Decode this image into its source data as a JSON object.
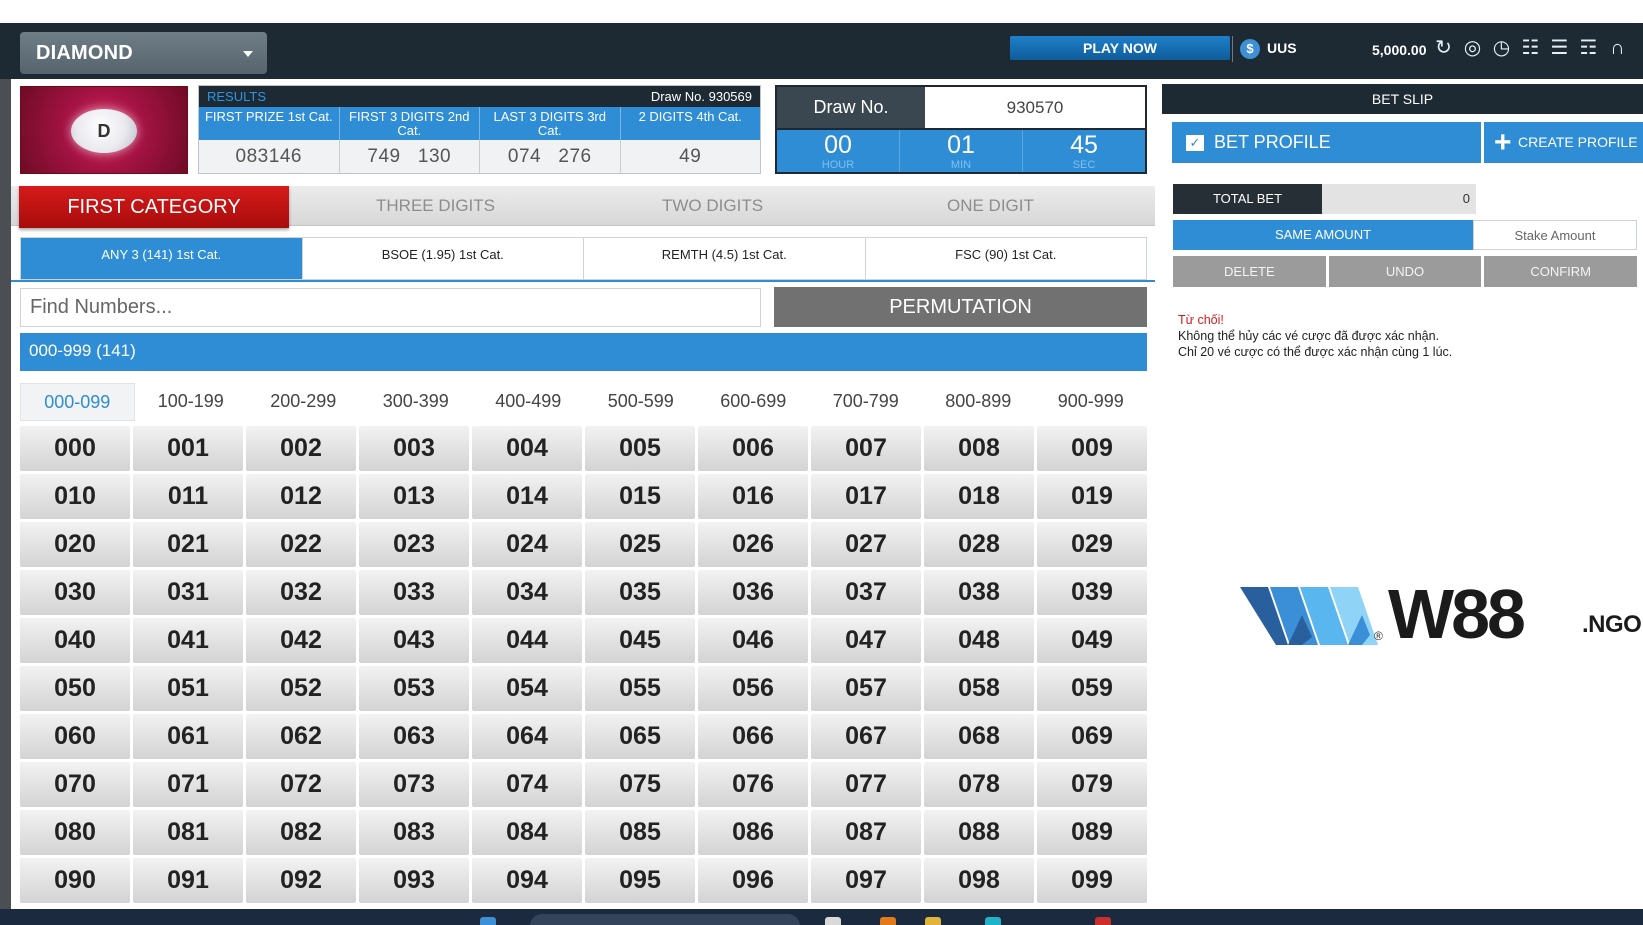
{
  "topbar": {
    "game": "DIAMOND",
    "play_now": "PLAY NOW",
    "currency": "UUS",
    "balance": "5,000.00",
    "tool_icons": [
      "refresh-icon",
      "lifebuoy-icon",
      "history-icon",
      "document-icon",
      "clipboard-icon",
      "book-icon",
      "headset-icon"
    ]
  },
  "logo": {
    "letter": "D"
  },
  "results": {
    "label": "RESULTS",
    "draw_no": "Draw No. 930569",
    "categories": [
      "FIRST PRIZE 1st Cat.",
      "FIRST 3 DIGITS 2nd Cat.",
      "LAST 3 DIGITS 3rd Cat.",
      "2 DIGITS 4th Cat."
    ],
    "values": [
      "083146",
      "749   130",
      "074   276",
      "49"
    ]
  },
  "draw": {
    "label": "Draw No.",
    "value": "930570",
    "hour": "00",
    "hour_label": "HOUR",
    "min": "01",
    "min_label": "MIN",
    "sec": "45",
    "sec_label": "SEC"
  },
  "categories": {
    "first": "FIRST CATEGORY",
    "three": "THREE DIGITS",
    "two": "TWO DIGITS",
    "one": "ONE DIGIT"
  },
  "subtabs": [
    "ANY 3 (141) 1st Cat.",
    "BSOE (1.95) 1st Cat.",
    "REMTH (4.5) 1st Cat.",
    "FSC (90) 1st Cat."
  ],
  "search": {
    "placeholder": "Find Numbers..."
  },
  "permutation": "PERMUTATION",
  "range_title": "000-999 (141)",
  "ranges": [
    "000-099",
    "100-199",
    "200-299",
    "300-399",
    "400-499",
    "500-599",
    "600-699",
    "700-799",
    "800-899",
    "900-999"
  ],
  "numbers": [
    "000",
    "001",
    "002",
    "003",
    "004",
    "005",
    "006",
    "007",
    "008",
    "009",
    "010",
    "011",
    "012",
    "013",
    "014",
    "015",
    "016",
    "017",
    "018",
    "019",
    "020",
    "021",
    "022",
    "023",
    "024",
    "025",
    "026",
    "027",
    "028",
    "029",
    "030",
    "031",
    "032",
    "033",
    "034",
    "035",
    "036",
    "037",
    "038",
    "039",
    "040",
    "041",
    "042",
    "043",
    "044",
    "045",
    "046",
    "047",
    "048",
    "049",
    "050",
    "051",
    "052",
    "053",
    "054",
    "055",
    "056",
    "057",
    "058",
    "059",
    "060",
    "061",
    "062",
    "063",
    "064",
    "065",
    "066",
    "067",
    "068",
    "069",
    "070",
    "071",
    "072",
    "073",
    "074",
    "075",
    "076",
    "077",
    "078",
    "079",
    "080",
    "081",
    "082",
    "083",
    "084",
    "085",
    "086",
    "087",
    "088",
    "089",
    "090",
    "091",
    "092",
    "093",
    "094",
    "095",
    "096",
    "097",
    "098",
    "099"
  ],
  "betslip": {
    "title": "BET SLIP",
    "bet_profile": "BET PROFILE",
    "create_profile": "CREATE PROFILE",
    "total_bet_label": "TOTAL BET",
    "total_bet_value": "0",
    "same_amount": "SAME AMOUNT",
    "stake_placeholder": "Stake Amount",
    "delete": "DELETE",
    "undo": "UNDO",
    "confirm": "CONFIRM",
    "msg_error": "Từ chối!",
    "msg_line1": "Không thể hủy các vé cược đã được xác nhận.",
    "msg_line2": "Chỉ 20 vé cược có thể được xác nhận cùng 1 lúc."
  },
  "brand": {
    "word": "W88",
    "suffix": ".NGO",
    "reg": "®"
  },
  "colors": {
    "accent": "#2e8dd4",
    "dark": "#1e2a33",
    "red": "#c41212"
  }
}
